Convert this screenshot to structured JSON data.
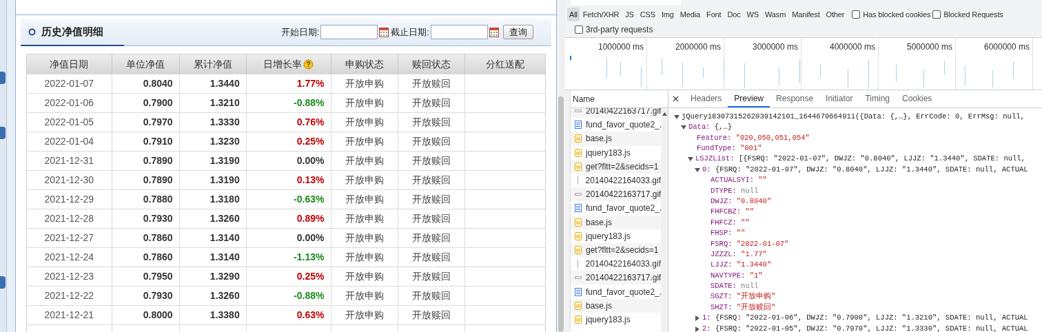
{
  "fund_page": {
    "section_title": "历史净值明细",
    "start_label": "开始日期:",
    "end_label": "截止日期:",
    "query_button": "查询",
    "columns": [
      {
        "label": "净值日期",
        "help": false
      },
      {
        "label": "单位净值",
        "help": false
      },
      {
        "label": "累计净值",
        "help": false
      },
      {
        "label": "日增长率",
        "help": true
      },
      {
        "label": "申购状态",
        "help": false
      },
      {
        "label": "赎回状态",
        "help": false
      },
      {
        "label": "分红送配",
        "help": false
      }
    ],
    "rows": [
      {
        "date": "2022-01-07",
        "nav": "0.8040",
        "acc": "1.3440",
        "change": "1.77%",
        "color": "#c00000",
        "buy": "开放申购",
        "sell": "开放赎回"
      },
      {
        "date": "2022-01-06",
        "nav": "0.7900",
        "acc": "1.3210",
        "change": "-0.88%",
        "color": "#1a8a1a",
        "buy": "开放申购",
        "sell": "开放赎回"
      },
      {
        "date": "2022-01-05",
        "nav": "0.7970",
        "acc": "1.3330",
        "change": "0.76%",
        "color": "#c00000",
        "buy": "开放申购",
        "sell": "开放赎回"
      },
      {
        "date": "2022-01-04",
        "nav": "0.7910",
        "acc": "1.3230",
        "change": "0.25%",
        "color": "#c00000",
        "buy": "开放申购",
        "sell": "开放赎回"
      },
      {
        "date": "2021-12-31",
        "nav": "0.7890",
        "acc": "1.3190",
        "change": "0.00%",
        "color": "#333333",
        "buy": "开放申购",
        "sell": "开放赎回"
      },
      {
        "date": "2021-12-30",
        "nav": "0.7890",
        "acc": "1.3190",
        "change": "0.13%",
        "color": "#c00000",
        "buy": "开放申购",
        "sell": "开放赎回"
      },
      {
        "date": "2021-12-29",
        "nav": "0.7880",
        "acc": "1.3180",
        "change": "-0.63%",
        "color": "#1a8a1a",
        "buy": "开放申购",
        "sell": "开放赎回"
      },
      {
        "date": "2021-12-28",
        "nav": "0.7930",
        "acc": "1.3260",
        "change": "0.89%",
        "color": "#c00000",
        "buy": "开放申购",
        "sell": "开放赎回"
      },
      {
        "date": "2021-12-27",
        "nav": "0.7860",
        "acc": "1.3140",
        "change": "0.00%",
        "color": "#333333",
        "buy": "开放申购",
        "sell": "开放赎回"
      },
      {
        "date": "2021-12-24",
        "nav": "0.7860",
        "acc": "1.3140",
        "change": "-1.13%",
        "color": "#1a8a1a",
        "buy": "开放申购",
        "sell": "开放赎回"
      },
      {
        "date": "2021-12-23",
        "nav": "0.7950",
        "acc": "1.3290",
        "change": "0.25%",
        "color": "#c00000",
        "buy": "开放申购",
        "sell": "开放赎回"
      },
      {
        "date": "2021-12-22",
        "nav": "0.7930",
        "acc": "1.3260",
        "change": "-0.88%",
        "color": "#1a8a1a",
        "buy": "开放申购",
        "sell": "开放赎回"
      },
      {
        "date": "2021-12-21",
        "nav": "0.8000",
        "acc": "1.3380",
        "change": "0.63%",
        "color": "#c00000",
        "buy": "开放申购",
        "sell": "开放赎回"
      }
    ]
  },
  "devtools": {
    "type_filters": [
      {
        "label": "All",
        "selected": true
      },
      {
        "label": "Fetch/XHR",
        "selected": false
      },
      {
        "label": "JS",
        "selected": false
      },
      {
        "label": "CSS",
        "selected": false
      },
      {
        "label": "Img",
        "selected": false
      },
      {
        "label": "Media",
        "selected": false
      },
      {
        "label": "Font",
        "selected": false
      },
      {
        "label": "Doc",
        "selected": false
      },
      {
        "label": "WS",
        "selected": false
      },
      {
        "label": "Wasm",
        "selected": false
      },
      {
        "label": "Manifest",
        "selected": false
      },
      {
        "label": "Other",
        "selected": false
      }
    ],
    "checkboxes": [
      {
        "label": "Has blocked cookies",
        "checked": false
      },
      {
        "label": "Blocked Requests",
        "checked": false
      },
      {
        "label": "3rd-party requests",
        "checked": false
      }
    ],
    "timeline_ticks": [
      "1000000 ms",
      "2000000 ms",
      "3000000 ms",
      "4000000 ms",
      "5000000 ms",
      "6000000 ms"
    ],
    "name_header": "Name",
    "requests": [
      {
        "name": "20140422163717.gif",
        "kind": "bar"
      },
      {
        "name": "fund_favor_quote2_.",
        "kind": "doc"
      },
      {
        "name": "base.js",
        "kind": "script"
      },
      {
        "name": "jquery183.js",
        "kind": "script"
      },
      {
        "name": "get?fltt=2&secids=1",
        "kind": "script"
      },
      {
        "name": "20140422164033.gif",
        "kind": "line"
      },
      {
        "name": "20140422163717.gif",
        "kind": "bar"
      },
      {
        "name": "fund_favor_quote2_.",
        "kind": "doc"
      },
      {
        "name": "base.js",
        "kind": "script"
      },
      {
        "name": "jquery183.js",
        "kind": "script"
      },
      {
        "name": "get?fltt=2&secids=1",
        "kind": "script"
      },
      {
        "name": "20140422164033.gif",
        "kind": "line"
      },
      {
        "name": "20140422163717.gif",
        "kind": "bar"
      },
      {
        "name": "fund_favor_quote2_.",
        "kind": "doc"
      },
      {
        "name": "base.js",
        "kind": "script"
      },
      {
        "name": "jquery183.js",
        "kind": "script"
      }
    ],
    "detail_tabs": [
      {
        "label": "Headers",
        "selected": false
      },
      {
        "label": "Preview",
        "selected": true
      },
      {
        "label": "Response",
        "selected": false
      },
      {
        "label": "Initiator",
        "selected": false
      },
      {
        "label": "Timing",
        "selected": false
      },
      {
        "label": "Cookies",
        "selected": false
      }
    ],
    "preview": [
      {
        "value": "jQuery18307315262039142101_1644670664911({Data: {,…}, ErrCode: 0, ErrMsg: null,",
        "kind": "summary",
        "expanded": true,
        "children": [
          {
            "key": "Data:",
            "value": "{,…}",
            "kind": "summary",
            "expanded": true,
            "children": [
              {
                "key": "Feature:",
                "value": "\"020,050,051,054\"",
                "kind": "string"
              },
              {
                "key": "FundType:",
                "value": "\"001\"",
                "kind": "string"
              },
              {
                "key": "LSJZList:",
                "value": "[{FSRQ: \"2022-01-07\", DWJZ: \"0.8040\", LJJZ: \"1.3440\", SDATE: null,",
                "kind": "summary",
                "expanded": true,
                "children": [
                  {
                    "key": "0:",
                    "value": "{FSRQ: \"2022-01-07\", DWJZ: \"0.8040\", LJJZ: \"1.3440\", SDATE: null, ACTUAL",
                    "kind": "summary",
                    "expanded": true,
                    "children": [
                      {
                        "key": "ACTUALSYI:",
                        "value": "\"\"",
                        "kind": "string"
                      },
                      {
                        "key": "DTYPE:",
                        "value": "null",
                        "kind": "null"
                      },
                      {
                        "key": "DWJZ:",
                        "value": "\"0.8040\"",
                        "kind": "string"
                      },
                      {
                        "key": "FHFCBZ:",
                        "value": "\"\"",
                        "kind": "string"
                      },
                      {
                        "key": "FHFCZ:",
                        "value": "\"\"",
                        "kind": "string"
                      },
                      {
                        "key": "FHSP:",
                        "value": "\"\"",
                        "kind": "string"
                      },
                      {
                        "key": "FSRQ:",
                        "value": "\"2022-01-07\"",
                        "kind": "string"
                      },
                      {
                        "key": "JZZZL:",
                        "value": "\"1.77\"",
                        "kind": "string"
                      },
                      {
                        "key": "LJJZ:",
                        "value": "\"1.3440\"",
                        "kind": "string"
                      },
                      {
                        "key": "NAVTYPE:",
                        "value": "\"1\"",
                        "kind": "string"
                      },
                      {
                        "key": "SDATE:",
                        "value": "null",
                        "kind": "null"
                      },
                      {
                        "key": "SGZT:",
                        "value": "\"开放申购\"",
                        "kind": "string"
                      },
                      {
                        "key": "SHZT:",
                        "value": "\"开放赎回\"",
                        "kind": "string"
                      }
                    ]
                  },
                  {
                    "key": "1:",
                    "value": "{FSRQ: \"2022-01-06\", DWJZ: \"0.7900\", LJJZ: \"1.3210\", SDATE: null, ACTUAL",
                    "kind": "summary",
                    "expanded": false
                  },
                  {
                    "key": "2:",
                    "value": "{FSRQ: \"2022-01-05\", DWJZ: \"0.7970\", LJJZ: \"1.3330\", SDATE: null, ACTUAL",
                    "kind": "summary",
                    "expanded": false
                  }
                ]
              }
            ]
          }
        ]
      }
    ]
  }
}
